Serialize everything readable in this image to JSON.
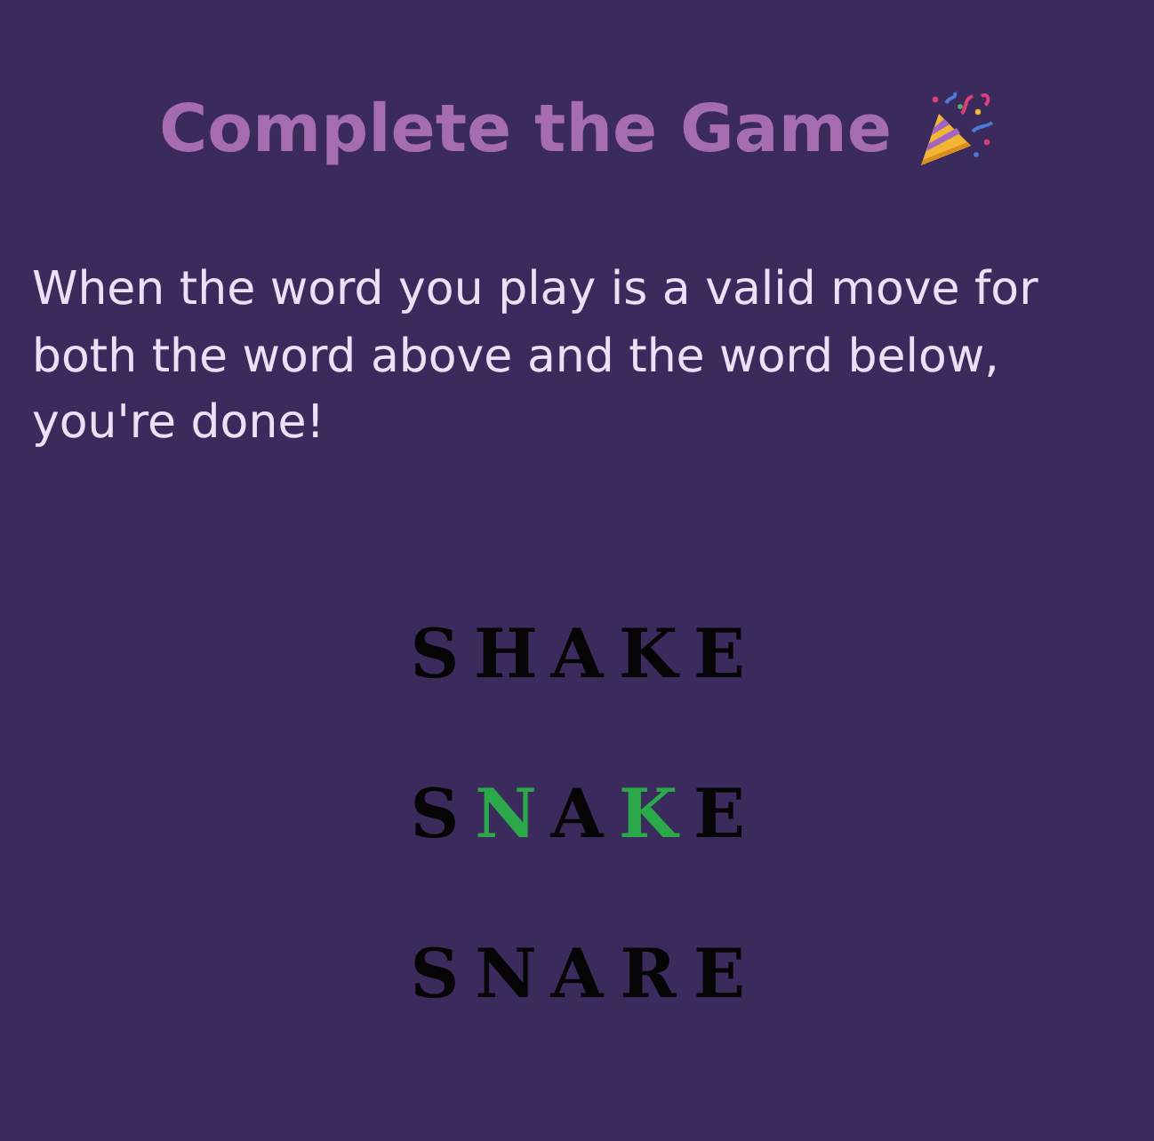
{
  "title": "Complete the Game",
  "message": "When the word you play is a valid move for both the word above and the word below, you're done!",
  "words": [
    {
      "letters": [
        {
          "char": "S",
          "highlighted": false
        },
        {
          "char": "H",
          "highlighted": false
        },
        {
          "char": "A",
          "highlighted": false
        },
        {
          "char": "K",
          "highlighted": false
        },
        {
          "char": "E",
          "highlighted": false
        }
      ]
    },
    {
      "letters": [
        {
          "char": "S",
          "highlighted": false
        },
        {
          "char": "N",
          "highlighted": true
        },
        {
          "char": "A",
          "highlighted": false
        },
        {
          "char": "K",
          "highlighted": true
        },
        {
          "char": "E",
          "highlighted": false
        }
      ]
    },
    {
      "letters": [
        {
          "char": "S",
          "highlighted": false
        },
        {
          "char": "N",
          "highlighted": false
        },
        {
          "char": "A",
          "highlighted": false
        },
        {
          "char": "R",
          "highlighted": false
        },
        {
          "char": "E",
          "highlighted": false
        }
      ]
    }
  ]
}
